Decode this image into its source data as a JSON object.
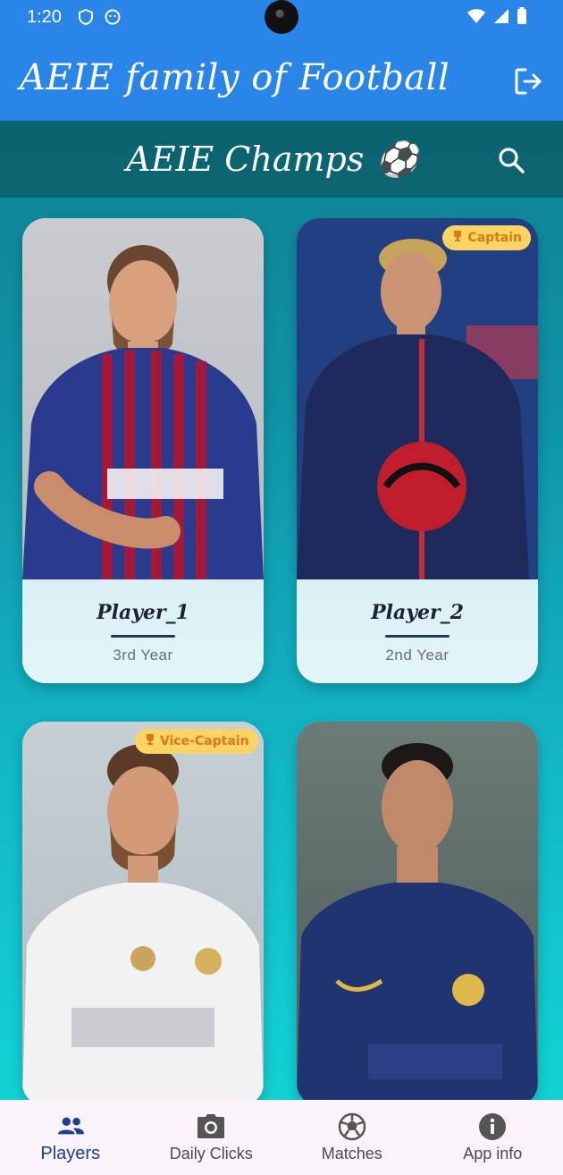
{
  "status_bar": {
    "time": "1:20"
  },
  "app_bar": {
    "title": "AEIE family of Football"
  },
  "sub_header": {
    "title": "AEIE Champs",
    "emoji": "⚽"
  },
  "players": [
    {
      "name": "Player_1",
      "year": "3rd Year",
      "badge": "",
      "jersey_color": "#2a3b8f"
    },
    {
      "name": "Player_2",
      "year": "2nd Year",
      "badge": "Captain",
      "jersey_color": "#1f2a5c"
    },
    {
      "name": "",
      "year": "",
      "badge": "Vice-Captain",
      "jersey_color": "#f2f2f2"
    },
    {
      "name": "",
      "year": "",
      "badge": "",
      "jersey_color": "#1f3470"
    }
  ],
  "bottom_nav": {
    "items": [
      {
        "label": "Players",
        "icon": "players-icon"
      },
      {
        "label": "Daily Clicks",
        "icon": "camera-icon"
      },
      {
        "label": "Matches",
        "icon": "soccer-ball-icon"
      },
      {
        "label": "App info",
        "icon": "info-icon"
      }
    ]
  },
  "colors": {
    "app_bar": "#2a85e8",
    "badge_bg": "#ffd465",
    "badge_text": "#e0761a",
    "active_nav": "#1c3f8f"
  }
}
